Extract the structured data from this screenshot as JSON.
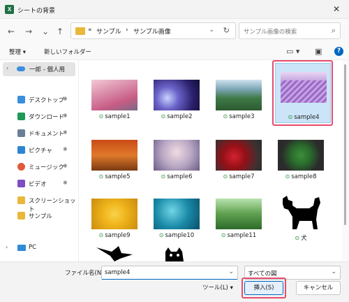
{
  "window": {
    "title": "シートの背景",
    "app_icon": "X",
    "close_glyph": "✕"
  },
  "nav": {
    "back_glyph": "←",
    "forward_glyph": "→",
    "recent_glyph": "⌄",
    "up_glyph": "↑",
    "address": {
      "prefix": "«",
      "crumb1": "サンプル",
      "sep": "›",
      "crumb2": "サンプル画像",
      "dropdown_glyph": "⌄",
      "refresh_glyph": "↻"
    },
    "search": {
      "placeholder": "サンプル画像の検索",
      "icon_glyph": "⌕"
    }
  },
  "toolbar": {
    "organize": "整理 ▾",
    "new_folder": "新しいフォルダー",
    "view_glyph": "▭ ▾",
    "pane_glyph": "▣",
    "help_glyph": "?"
  },
  "sidebar": {
    "top": {
      "chevron": "›",
      "label": "一郎 - 個人用"
    },
    "pin_glyph": "✱",
    "items": [
      {
        "label": "デスクトップ",
        "color": "#3a8fdc"
      },
      {
        "label": "ダウンロード",
        "color": "#1e9a58"
      },
      {
        "label": "ドキュメント",
        "color": "#6a7f93"
      },
      {
        "label": "ピクチャ",
        "color": "#2e84d4"
      },
      {
        "label": "ミュージック",
        "color": "#e25a3a"
      },
      {
        "label": "ビデオ",
        "color": "#7d4dc3"
      },
      {
        "label": "スクリーンショット",
        "color": "#e9b73b"
      },
      {
        "label": "サンプル",
        "color": "#e9b73b"
      }
    ],
    "pc": {
      "chevron": "›",
      "label": "PC"
    }
  },
  "files": {
    "check_glyph": "⊙",
    "items": [
      {
        "name": "sample1"
      },
      {
        "name": "sample2"
      },
      {
        "name": "sample3"
      },
      {
        "name": "sample4"
      },
      {
        "name": "sample5"
      },
      {
        "name": "sample6"
      },
      {
        "name": "sample7"
      },
      {
        "name": "sample8"
      },
      {
        "name": "sample9"
      },
      {
        "name": "sample10"
      },
      {
        "name": "sample11"
      },
      {
        "name": "犬"
      }
    ],
    "selected": "sample4"
  },
  "footer": {
    "filename_label": "ファイル名(N):",
    "filename_value": "sample4",
    "filetype_value": "すべての図",
    "tools_label": "ツール(L) ▾",
    "insert_button": "挿入(S)",
    "cancel_button": "キャンセル"
  },
  "colors": {
    "accent": "#0067c0",
    "highlight": "#e74c6f",
    "selected_bg": "#cce4f7"
  }
}
